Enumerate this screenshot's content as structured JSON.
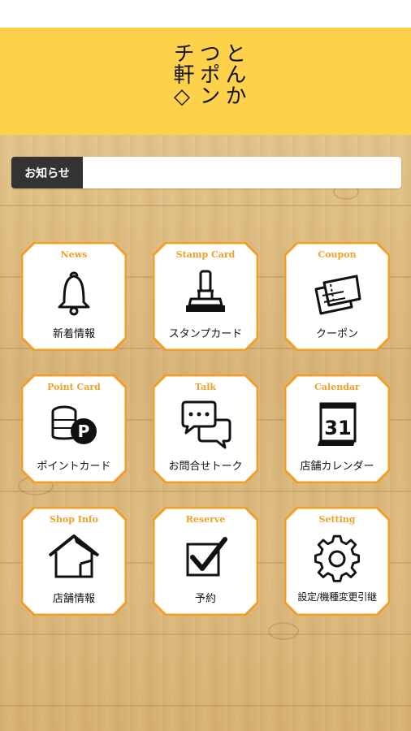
{
  "app": {
    "logo_lines": [
      "とんか",
      "つポン",
      "チ軒◇"
    ]
  },
  "news": {
    "label": "お知らせ",
    "text": ""
  },
  "menu": [
    {
      "en": "News",
      "jp": "新着情報",
      "icon": "bell-icon"
    },
    {
      "en": "Stamp Card",
      "jp": "スタンプカード",
      "icon": "stamp-icon"
    },
    {
      "en": "Coupon",
      "jp": "クーポン",
      "icon": "coupon-icon"
    },
    {
      "en": "Point Card",
      "jp": "ポイントカード",
      "icon": "coins-icon"
    },
    {
      "en": "Talk",
      "jp": "お問合せトーク",
      "icon": "chat-bubbles-icon"
    },
    {
      "en": "Calendar",
      "jp": "店舗カレンダー",
      "icon": "calendar-icon",
      "calendar_day": "31"
    },
    {
      "en": "Shop Info",
      "jp": "店舗情報",
      "icon": "house-icon"
    },
    {
      "en": "Reserve",
      "jp": "予約",
      "icon": "checkbox-icon"
    },
    {
      "en": "Setting",
      "jp": "設定/機種変更引継",
      "icon": "gear-icon"
    }
  ],
  "colors": {
    "header": "#fdd24a",
    "accent": "#f0a029",
    "label_bg": "#333333"
  }
}
